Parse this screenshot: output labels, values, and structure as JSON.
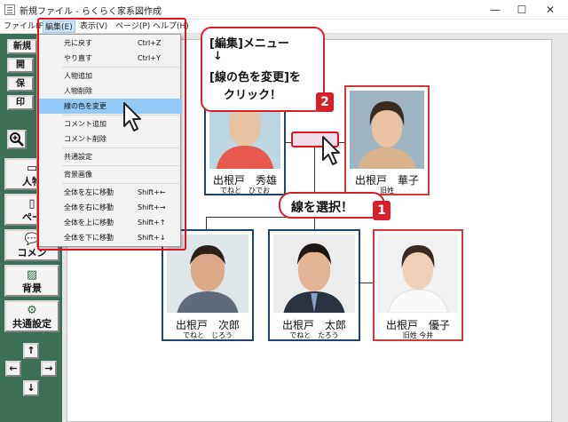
{
  "window": {
    "title": "新規ファイル - らくらく家系図作成",
    "minimize": "—",
    "maximize": "☐",
    "close": "✕"
  },
  "menubar": {
    "file": "ファイル(F)",
    "edit": "編集(E)",
    "view": "表示(V)",
    "page": "ページ(P)",
    "help": "ヘルプ(H)"
  },
  "sidebar": {
    "new": "新規",
    "open": "開",
    "save": "保",
    "print": "印",
    "person": "人物",
    "page": "ペー",
    "comment": "コメン",
    "background": "背景",
    "common_settings": "共通設定"
  },
  "edit_menu": {
    "items": [
      {
        "label": "元に戻す",
        "shortcut": "Ctrl+Z"
      },
      {
        "label": "やり直す",
        "shortcut": "Ctrl+Y"
      },
      {
        "label": "人物追加",
        "shortcut": ""
      },
      {
        "label": "人物削除",
        "shortcut": ""
      },
      {
        "label": "線の色を変更",
        "shortcut": ""
      },
      {
        "label": "コメント追加",
        "shortcut": ""
      },
      {
        "label": "コメント削除",
        "shortcut": ""
      },
      {
        "label": "共通設定",
        "shortcut": ""
      },
      {
        "label": "背景画像",
        "shortcut": ""
      },
      {
        "label": "全体を左に移動",
        "shortcut": "Shift+←"
      },
      {
        "label": "全体を右に移動",
        "shortcut": "Shift+→"
      },
      {
        "label": "全体を上に移動",
        "shortcut": "Shift+↑"
      },
      {
        "label": "全体を下に移動",
        "shortcut": "Shift+↓"
      }
    ],
    "highlighted": "線の色を変更"
  },
  "persons": [
    {
      "name": "出根戸　秀雄",
      "kana": "でねと　ひでお"
    },
    {
      "name": "出根戸　華子",
      "kana": "旧姓"
    },
    {
      "name": "出根戸　次郎",
      "kana": "でねと　じろう"
    },
    {
      "name": "出根戸　太郎",
      "kana": "でねと　たろう"
    },
    {
      "name": "出根戸　優子",
      "kana": "旧姓 今井"
    }
  ],
  "callouts": {
    "menu_instruction_line1": "[編集]メニュー",
    "menu_instruction_arrow": "↓",
    "menu_instruction_line2": "[線の色を変更]を",
    "menu_instruction_line3": "クリック！",
    "select_line": "線を選択！",
    "step1": "1",
    "step2": "2"
  },
  "colors": {
    "sidebar": "#3d6e56",
    "highlight_red": "#e1131f",
    "male_border": "#20446b",
    "female_border": "#d33a3a",
    "menu_selected": "#91c9f7"
  }
}
